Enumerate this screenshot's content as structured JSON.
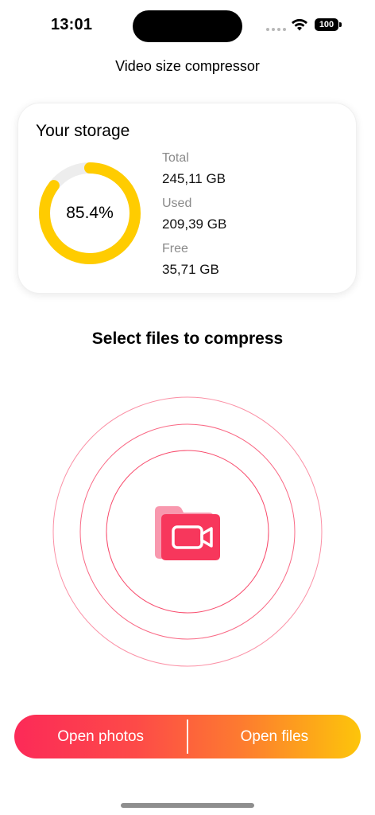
{
  "status_bar": {
    "time": "13:01",
    "battery": "100",
    "wifi_icon": "wifi-icon",
    "signal_icon": "cellular-signal-icon"
  },
  "header": {
    "title": "Video size compressor"
  },
  "storage": {
    "title": "Your storage",
    "used_percent_label": "85.4%",
    "used_fraction": 0.854,
    "ring_color": "#FFCC00",
    "ring_track_color": "#EDEDED",
    "total_label": "Total",
    "total_value": "245,11 GB",
    "used_label": "Used",
    "used_value": "209,39 GB",
    "free_label": "Free",
    "free_value": "35,71 GB"
  },
  "main": {
    "prompt": "Select files to compress",
    "icon": "video-folder-icon",
    "accent_color": "#F7375C"
  },
  "actions": {
    "open_photos": "Open photos",
    "open_files": "Open files",
    "gradient_start": "#FC2A58",
    "gradient_end": "#FDC50A"
  }
}
